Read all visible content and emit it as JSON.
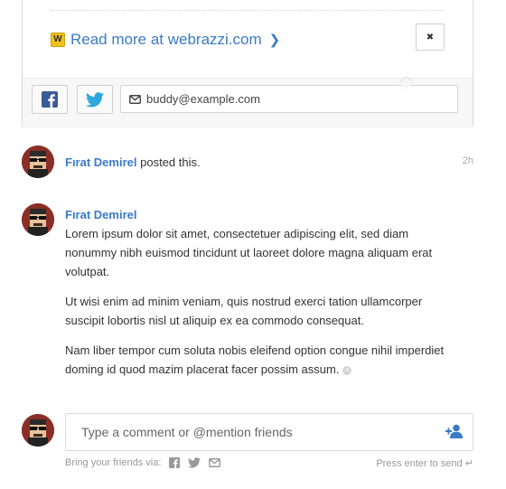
{
  "card": {
    "read_more_label": "Read more at webrazzi.com",
    "read_more_badge": "W",
    "chevron": "❯",
    "close_glyph": "✖",
    "email_value": "buddy@example.com",
    "icons": [
      "webrazzi-w-icon",
      "chevron-right-icon",
      "close-icon",
      "facebook-icon",
      "twitter-icon",
      "envelope-icon"
    ]
  },
  "post": {
    "author": "Fırat Demirel",
    "action": "posted this.",
    "time": "2h"
  },
  "comment": {
    "author": "Fırat Demirel",
    "paragraphs": [
      "Lorem ipsum dolor sit amet, consectetuer adipiscing elit, sed diam nonummy nibh euismod tincidunt ut laoreet dolore magna aliquam erat volutpat.",
      "Ut wisi enim ad minim veniam, quis nostrud exerci tation ullamcorper suscipit lobortis nisl ut aliquip ex ea commodo consequat.",
      "Nam liber tempor cum soluta nobis eleifend option congue nihil imperdiet doming id quod mazim placerat facer possim assum."
    ],
    "delete_glyph": "×"
  },
  "composer": {
    "placeholder": "Type a comment or @mention friends",
    "bring_friends_label": "Bring your friends via:",
    "press_enter_label": "Press enter to send ↵"
  },
  "colors": {
    "link": "#3a7bc8",
    "facebook": "#3b5998",
    "twitter": "#2fa6dd",
    "badge": "#f2c21b"
  }
}
